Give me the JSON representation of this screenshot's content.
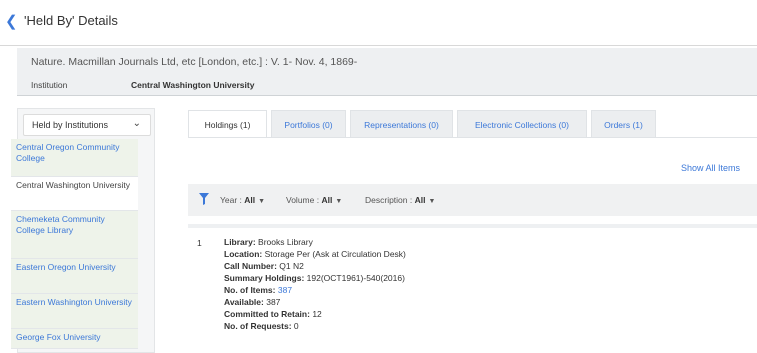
{
  "header": {
    "title": "'Held By' Details"
  },
  "record": {
    "title": "Nature. Macmillan Journals Ltd, etc [London, etc.] : V. 1- Nov. 4, 1869-",
    "institution_label": "Institution",
    "institution_value": "Central Washington University"
  },
  "sidebar": {
    "dropdown_label": "Held by Institutions",
    "items": [
      {
        "label": "Central Oregon Community College"
      },
      {
        "label": "Central Washington University"
      },
      {
        "label": "Chemeketa Community College Library"
      },
      {
        "label": "Eastern Oregon University"
      },
      {
        "label": "Eastern Washington University"
      },
      {
        "label": "George Fox University"
      }
    ]
  },
  "tabs": [
    {
      "label": "Holdings (1)"
    },
    {
      "label": "Portfolios (0)"
    },
    {
      "label": "Representations (0)"
    },
    {
      "label": "Electronic Collections (0)"
    },
    {
      "label": "Orders (1)"
    }
  ],
  "show_all": "Show All Items",
  "filters": {
    "year_label": "Year :",
    "year_value": "All",
    "volume_label": "Volume :",
    "volume_value": "All",
    "description_label": "Description :",
    "description_value": "All"
  },
  "holding": {
    "index": "1",
    "library_label": "Library:",
    "library_value": "Brooks Library",
    "location_label": "Location:",
    "location_value": "Storage Per (Ask at Circulation Desk)",
    "call_number_label": "Call Number:",
    "call_number_value": "Q1 N2",
    "summary_label": "Summary Holdings:",
    "summary_value": "192(OCT1961)-540(2016)",
    "items_label": "No. of Items:",
    "items_value": "387",
    "available_label": "Available:",
    "available_value": "387",
    "retain_label": "Committed to Retain:",
    "retain_value": "12",
    "requests_label": "No. of Requests:",
    "requests_value": "0"
  },
  "colors": {
    "link": "#3c78d8",
    "panel_bg": "#eef0f2"
  }
}
